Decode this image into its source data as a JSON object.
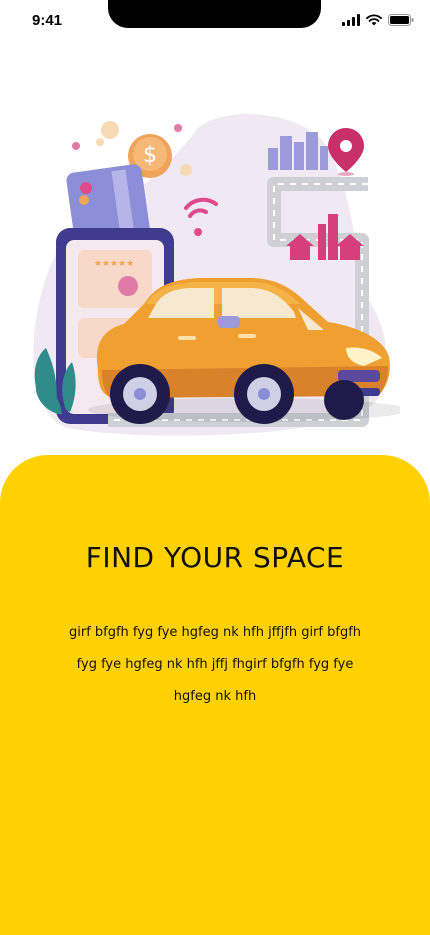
{
  "status_bar": {
    "time": "9:41"
  },
  "icons": [
    "signal-icon",
    "wifi-icon",
    "battery-icon"
  ],
  "onboarding": {
    "title": "FIND YOUR SPACE",
    "body": "girf bfgfh fyg fye hgfeg nk hfh jffjfh girf bfgfh fyg fye hgfeg nk hfh jffj fhgirf bfgfh fyg fye hgfeg nk hfh"
  },
  "colors": {
    "accent": "#FFD100",
    "car": "#F0A030"
  }
}
